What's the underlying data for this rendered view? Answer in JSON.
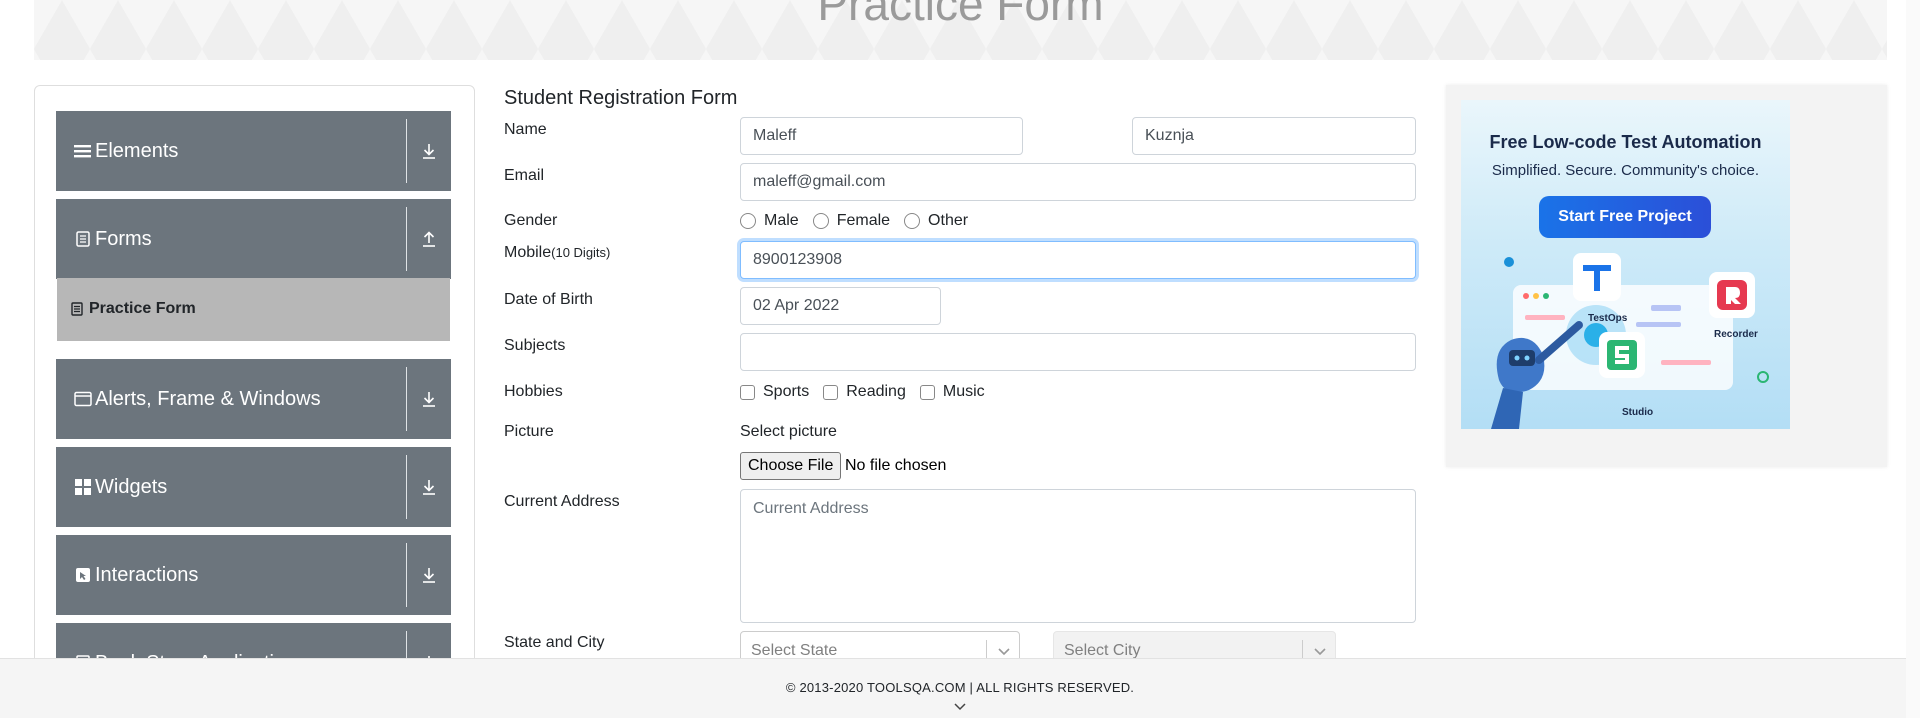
{
  "banner": {
    "title": "Practice Form"
  },
  "sidebar": {
    "groups": [
      {
        "label": "Elements",
        "icon": "list-icon"
      },
      {
        "label": "Forms",
        "icon": "document-icon"
      },
      {
        "label": "Alerts, Frame & Windows",
        "icon": "window-icon"
      },
      {
        "label": "Widgets",
        "icon": "grid-icon"
      },
      {
        "label": "Interactions",
        "icon": "cursor-icon"
      },
      {
        "label": "Book Store Application",
        "icon": "book-icon"
      }
    ],
    "active_item": {
      "label": "Practice Form",
      "icon": "document-icon"
    }
  },
  "form": {
    "title": "Student Registration Form",
    "name": {
      "label": "Name",
      "first_value": "Maleff",
      "last_value": "Kuznja"
    },
    "email": {
      "label": "Email",
      "value": "maleff@gmail.com"
    },
    "gender": {
      "label": "Gender",
      "options": [
        "Male",
        "Female",
        "Other"
      ]
    },
    "mobile": {
      "label": "Mobile",
      "hint": "(10 Digits)",
      "value": "8900123908"
    },
    "dob": {
      "label": "Date of Birth",
      "value": "02 Apr 2022"
    },
    "subjects": {
      "label": "Subjects",
      "value": ""
    },
    "hobbies": {
      "label": "Hobbies",
      "options": [
        "Sports",
        "Reading",
        "Music"
      ]
    },
    "picture": {
      "label": "Picture",
      "sub_label": "Select picture",
      "button": "Choose File",
      "status": "No file chosen"
    },
    "address": {
      "label": "Current Address",
      "placeholder": "Current Address"
    },
    "state_city": {
      "label": "State and City",
      "state_placeholder": "Select State",
      "city_placeholder": "Select City"
    }
  },
  "ad": {
    "title": "Free Low-code Test Automation",
    "subtitle": "Simplified. Secure. Community's choice.",
    "button": "Start Free Project",
    "captions": [
      "TestOps",
      "Recorder",
      "Studio"
    ]
  },
  "footer": {
    "text": "© 2013-2020 TOOLSQA.COM | ALL RIGHTS RESERVED."
  },
  "colors": {
    "sidebar_group": "#6c757d",
    "active_item": "#b7b7b7",
    "focus": "#80bdff",
    "ad_button": "#1a73e8"
  }
}
